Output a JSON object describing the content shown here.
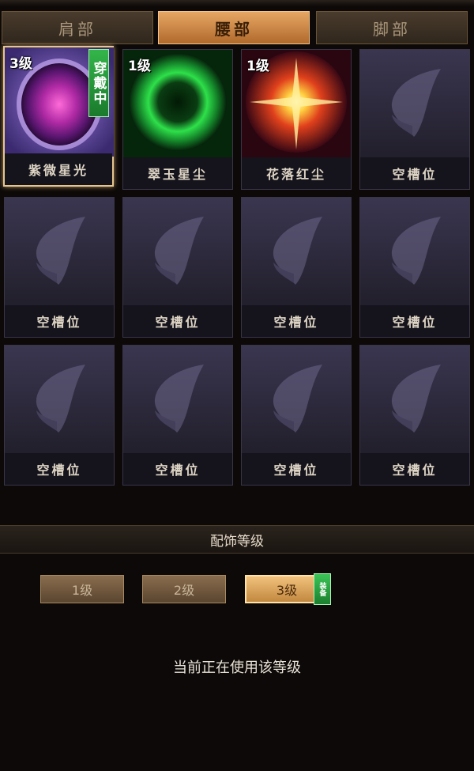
{
  "tabs": [
    "肩部",
    "腰部",
    "脚部"
  ],
  "active_tab": "腰部",
  "slots": [
    {
      "name": "紫微星光",
      "level": "3级",
      "wearing": "穿戴中",
      "icon": "purple-orb-icon"
    },
    {
      "name": "翠玉星尘",
      "level": "1级",
      "icon": "green-orb-icon"
    },
    {
      "name": "花落红尘",
      "level": "1级",
      "icon": "red-star-icon"
    },
    {
      "name": "空槽位",
      "icon": "butterfly-placeholder-icon"
    },
    {
      "name": "空槽位",
      "icon": "butterfly-placeholder-icon"
    },
    {
      "name": "空槽位",
      "icon": "butterfly-placeholder-icon"
    },
    {
      "name": "空槽位",
      "icon": "butterfly-placeholder-icon"
    },
    {
      "name": "空槽位",
      "icon": "butterfly-placeholder-icon"
    },
    {
      "name": "空槽位",
      "icon": "butterfly-placeholder-icon"
    },
    {
      "name": "空槽位",
      "icon": "butterfly-placeholder-icon"
    },
    {
      "name": "空槽位",
      "icon": "butterfly-placeholder-icon"
    },
    {
      "name": "空槽位",
      "icon": "butterfly-placeholder-icon"
    }
  ],
  "section": {
    "title": "配饰等级"
  },
  "level_buttons": [
    "1级",
    "2级",
    "3级"
  ],
  "active_level": "3级",
  "equip_badge": "装备",
  "status_text": "当前正在使用该等级",
  "colors": {
    "accent": "#e7a663",
    "badge": "#2fae48",
    "background": "#0c0908"
  }
}
